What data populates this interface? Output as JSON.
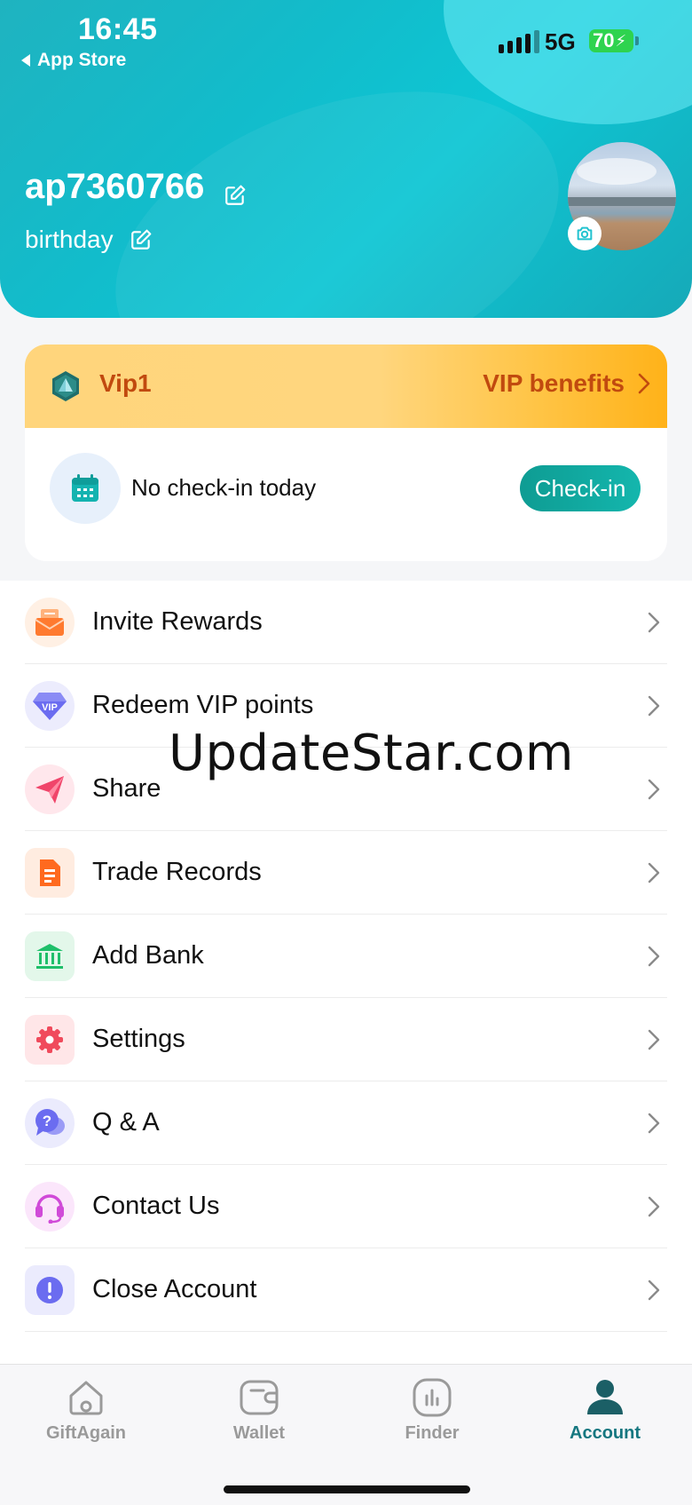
{
  "status_bar": {
    "time": "16:45",
    "back_label": "App Store",
    "network": "5G",
    "battery": "70"
  },
  "profile": {
    "username": "ap7360766",
    "birthday": "birthday"
  },
  "vip": {
    "level": "Vip1",
    "benefits_label": "VIP benefits",
    "checkin_status": "No check-in today",
    "checkin_button": "Check-in"
  },
  "menu": [
    {
      "label": "Invite Rewards",
      "icon": "envelope-icon",
      "color": "#ff7a2f",
      "bg": "#fff0e4"
    },
    {
      "label": "Redeem VIP points",
      "icon": "vip-diamond-icon",
      "color": "#6b6cf0",
      "bg": "#ececfd"
    },
    {
      "label": "Share",
      "icon": "paper-plane-icon",
      "color": "#f0456a",
      "bg": "#ffe7ec"
    },
    {
      "label": "Trade Records",
      "icon": "document-icon",
      "color": "#ff6a1f",
      "bg": "#ffece0"
    },
    {
      "label": "Add Bank",
      "icon": "bank-icon",
      "color": "#1fbf6a",
      "bg": "#e3f7ea"
    },
    {
      "label": "Settings",
      "icon": "gear-icon",
      "color": "#f04a5c",
      "bg": "#ffe6e8"
    },
    {
      "label": "Q & A",
      "icon": "question-bubble-icon",
      "color": "#6b6cf0",
      "bg": "#ebebfd"
    },
    {
      "label": "Contact Us",
      "icon": "headset-icon",
      "color": "#d04ad8",
      "bg": "#fbe6fb"
    },
    {
      "label": "Close Account",
      "icon": "alert-icon",
      "color": "#6b6cf0",
      "bg": "#ebebfd"
    }
  ],
  "watermark": "UpdateStar.com",
  "tabs": [
    {
      "label": "GiftAgain",
      "icon": "home-icon",
      "active": false
    },
    {
      "label": "Wallet",
      "icon": "wallet-icon",
      "active": false
    },
    {
      "label": "Finder",
      "icon": "finder-chart-icon",
      "active": false
    },
    {
      "label": "Account",
      "icon": "account-icon",
      "active": true
    }
  ],
  "colors": {
    "accent": "#157780",
    "header": "#12bccb",
    "vip_text": "#c14a0f"
  }
}
